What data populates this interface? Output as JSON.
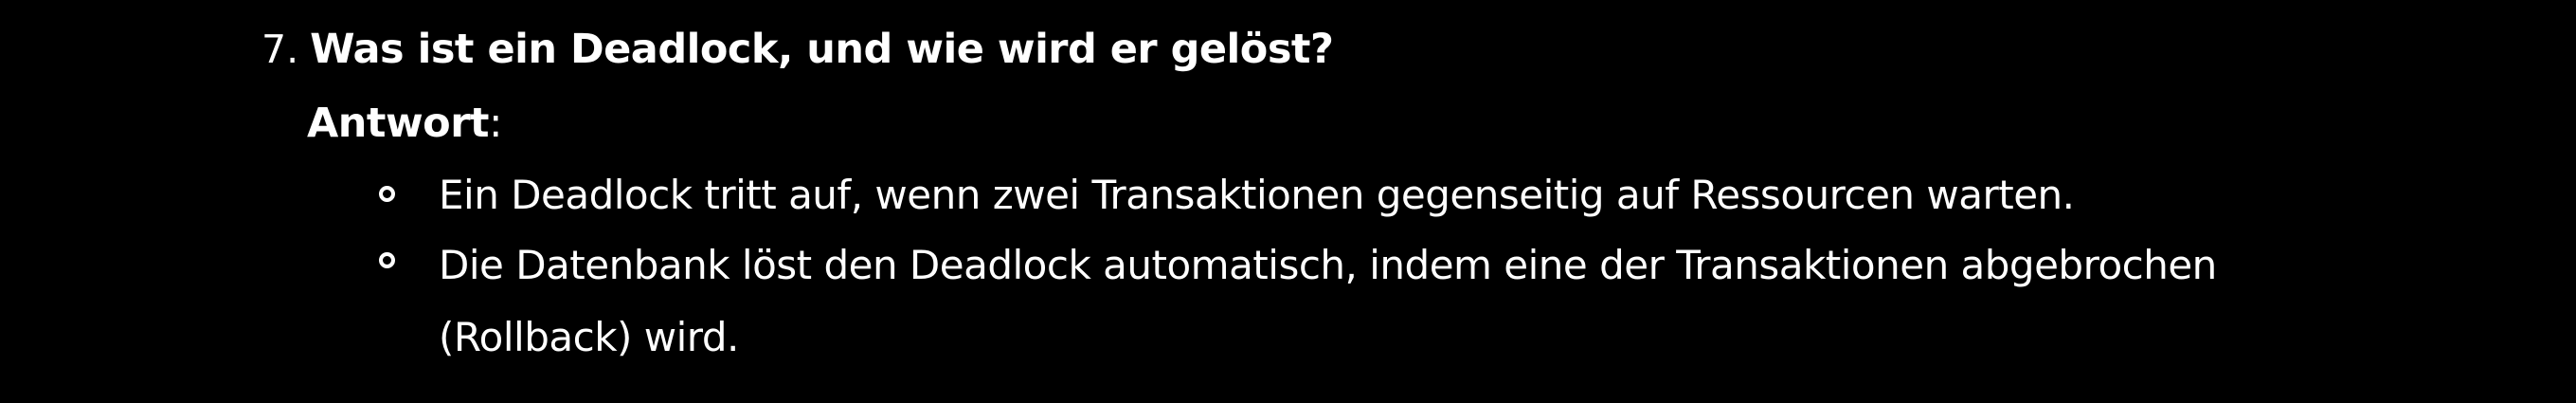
{
  "question": {
    "number": "7.",
    "text": "Was ist ein Deadlock, und wie wird er gelöst?"
  },
  "answer": {
    "label": "Antwort",
    "colon": ":",
    "bullets": [
      {
        "lines": [
          "Ein Deadlock tritt auf, wenn zwei Transaktionen gegenseitig auf Ressourcen warten."
        ]
      },
      {
        "lines": [
          "Die Datenbank löst den Deadlock automatisch, indem eine der Transaktionen abgebrochen",
          "(Rollback) wird."
        ]
      }
    ]
  }
}
